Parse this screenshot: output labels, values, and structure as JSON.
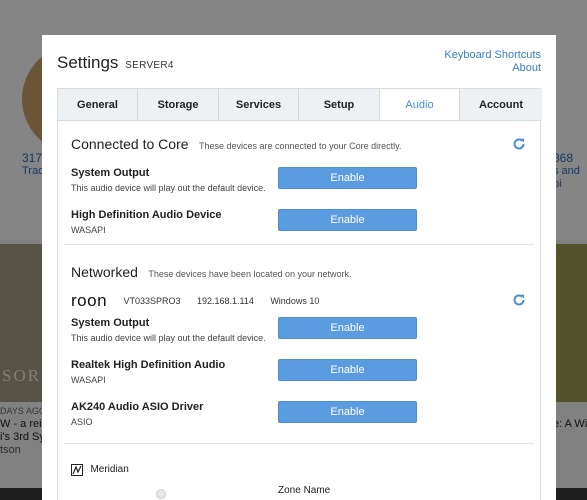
{
  "background": {
    "stat_left_number": "317",
    "stat_left_label": "Track",
    "stat_right_number": "368",
    "stat_right_label": "s and bi",
    "album_left_text": "SORE",
    "left_date": "DAYS AGO",
    "left_line1": "W - a rei",
    "left_line2": "i's 3rd Sy",
    "left_line3": "tson",
    "right_line1": "e: A Win"
  },
  "modal": {
    "title": "Settings",
    "server_name": "SERVER4",
    "links": {
      "keyboard_shortcuts": "Keyboard Shortcuts",
      "about": "About"
    },
    "tabs": [
      {
        "label": "General"
      },
      {
        "label": "Storage"
      },
      {
        "label": "Services"
      },
      {
        "label": "Setup"
      },
      {
        "label": "Audio"
      },
      {
        "label": "Account"
      }
    ],
    "active_tab": "Audio"
  },
  "audio": {
    "connected": {
      "title": "Connected to Core",
      "description": "These devices are connected to your Core directly.",
      "devices": [
        {
          "name": "System Output",
          "description": "This audio device will play out the default device.",
          "button": "Enable"
        },
        {
          "name": "High Definition Audio Device",
          "description": "WASAPI",
          "button": "Enable"
        }
      ]
    },
    "networked": {
      "title": "Networked",
      "description": "These devices have been located on your network.",
      "roon_logo": "roon",
      "host": "VT033SPRO3",
      "ip": "192.168.1.114",
      "os": "Windows 10",
      "devices": [
        {
          "name": "System Output",
          "description": "This audio device will play out the default device.",
          "button": "Enable"
        },
        {
          "name": "Realtek High Definition Audio",
          "description": "WASAPI",
          "button": "Enable"
        },
        {
          "name": "AK240 Audio ASIO Driver",
          "description": "ASIO",
          "button": "Enable"
        }
      ]
    },
    "meridian": {
      "label": "Meridian",
      "zone_label": "Zone Name"
    }
  },
  "colors": {
    "accent": "#5b9be0",
    "link": "#3a80c9",
    "active_tab_text": "#4b8fd6"
  }
}
